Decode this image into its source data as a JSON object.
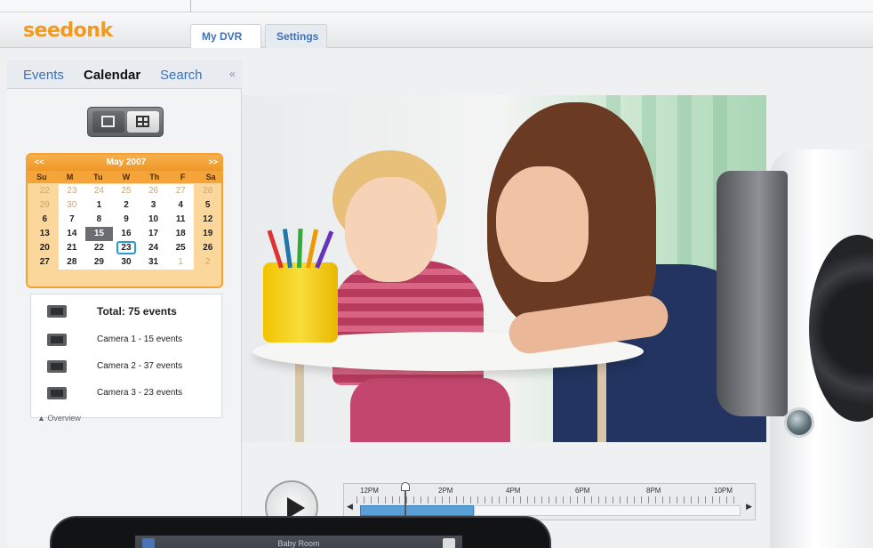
{
  "header": {
    "logo_text": "seedonk",
    "tabs": [
      {
        "label": "My DVR",
        "active": true
      },
      {
        "label": "Settings",
        "active": false
      }
    ]
  },
  "subnav": {
    "items": [
      "Events",
      "Calendar",
      "Search"
    ],
    "active": "Calendar",
    "collapse_icon": "double-chevron-left-icon"
  },
  "view_toggle": {
    "options": [
      "single-view-icon",
      "grid-view-icon"
    ]
  },
  "calendar": {
    "prev": "<<",
    "next": ">>",
    "title": "May 2007",
    "weekdays": [
      "Su",
      "M",
      "Tu",
      "W",
      "Th",
      "F",
      "Sa"
    ],
    "days": [
      "22",
      "23",
      "24",
      "25",
      "26",
      "27",
      "28",
      "29",
      "30",
      "1",
      "2",
      "3",
      "4",
      "5",
      "6",
      "7",
      "8",
      "9",
      "10",
      "11",
      "12",
      "13",
      "14",
      "15",
      "16",
      "17",
      "18",
      "19",
      "20",
      "21",
      "22",
      "23",
      "24",
      "25",
      "26",
      "27",
      "28",
      "29",
      "30",
      "31",
      "1",
      "2"
    ],
    "selected": "15",
    "today": "23"
  },
  "events": {
    "total": "Total: 75 events",
    "cameras": [
      "Camera 1 - 15 events",
      "Camera 2 - 37 events",
      "Camera 3 - 23 events"
    ],
    "overview_label": "▲ Overview"
  },
  "timeline": {
    "labels": [
      "12PM",
      "2PM",
      "4PM",
      "6PM",
      "8PM",
      "10PM"
    ]
  },
  "phone": {
    "title": "Baby Room"
  },
  "colors": {
    "brand_orange": "#f39a1e",
    "link_blue": "#3b72b8",
    "calendar_orange": "#f3a233",
    "timeline_blue": "#5a9fd8",
    "today_ring": "#2a9ad6"
  }
}
